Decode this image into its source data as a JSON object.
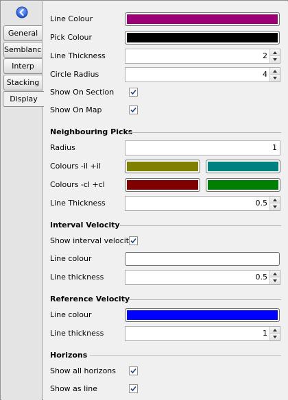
{
  "tabs": [
    {
      "label": "General"
    },
    {
      "label": "Semblance"
    },
    {
      "label": "Interp"
    },
    {
      "label": "Stacking"
    },
    {
      "label": "Display"
    }
  ],
  "back_icon": "back-arrow-icon",
  "general": {
    "line_colour_label": "Line Colour",
    "line_colour": "#9b0077",
    "pick_colour_label": "Pick Colour",
    "pick_colour": "#000000",
    "line_thickness_label": "Line Thickness",
    "line_thickness": "2",
    "circle_radius_label": "Circle Radius",
    "circle_radius": "4",
    "show_on_section_label": "Show On Section",
    "show_on_section": true,
    "show_on_map_label": "Show On Map",
    "show_on_map": true
  },
  "neighbouring": {
    "title": "Neighbouring Picks",
    "radius_label": "Radius",
    "radius": "1",
    "colours_il_label": "Colours -il +il",
    "colour_minus_il": "#808000",
    "colour_plus_il": "#008080",
    "colours_cl_label": "Colours -cl +cl",
    "colour_minus_cl": "#800000",
    "colour_plus_cl": "#008000",
    "line_thickness_label": "Line Thickness",
    "line_thickness": "0.5"
  },
  "interval": {
    "title": "Interval Velocity",
    "show_label": "Show interval velocity",
    "show": true,
    "line_colour_label": "Line colour",
    "line_colour": "#ffffff",
    "line_thickness_label": "Line thickness",
    "line_thickness": "0.5"
  },
  "reference": {
    "title": "Reference Velocity",
    "line_colour_label": "Line colour",
    "line_colour": "#0000ff",
    "line_thickness_label": "Line thickness",
    "line_thickness": "1"
  },
  "horizons": {
    "title": "Horizons",
    "show_all_label": "Show all horizons",
    "show_all": true,
    "show_as_line_label": "Show as line",
    "show_as_line": true
  }
}
